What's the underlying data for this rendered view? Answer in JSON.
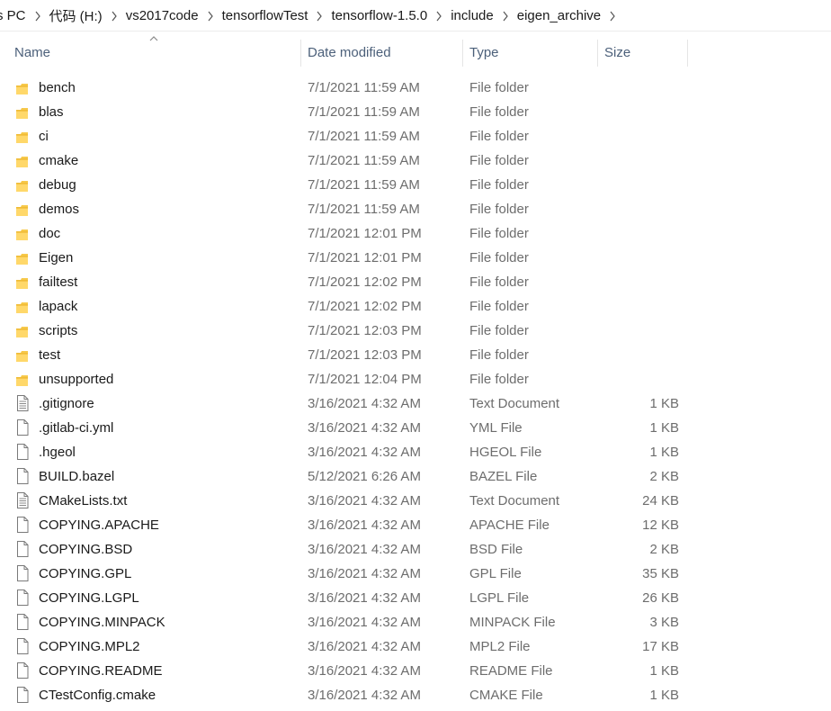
{
  "breadcrumb": [
    {
      "label": "s PC"
    },
    {
      "label": "代码 (H:)"
    },
    {
      "label": "vs2017code"
    },
    {
      "label": "tensorflowTest"
    },
    {
      "label": "tensorflow-1.5.0"
    },
    {
      "label": "include"
    },
    {
      "label": "eigen_archive"
    }
  ],
  "columns": {
    "name": "Name",
    "date": "Date modified",
    "type": "Type",
    "size": "Size"
  },
  "sort": {
    "column": "name",
    "direction": "ascending"
  },
  "colors": {
    "folder": "#f7c94b",
    "header_text": "#4c607a",
    "secondary_text": "#6d6d6d"
  },
  "files": [
    {
      "name": "bench",
      "date": "7/1/2021 11:59 AM",
      "type": "File folder",
      "size": "",
      "icon": "folder-icon"
    },
    {
      "name": "blas",
      "date": "7/1/2021 11:59 AM",
      "type": "File folder",
      "size": "",
      "icon": "folder-icon"
    },
    {
      "name": "ci",
      "date": "7/1/2021 11:59 AM",
      "type": "File folder",
      "size": "",
      "icon": "folder-icon"
    },
    {
      "name": "cmake",
      "date": "7/1/2021 11:59 AM",
      "type": "File folder",
      "size": "",
      "icon": "folder-icon"
    },
    {
      "name": "debug",
      "date": "7/1/2021 11:59 AM",
      "type": "File folder",
      "size": "",
      "icon": "folder-icon"
    },
    {
      "name": "demos",
      "date": "7/1/2021 11:59 AM",
      "type": "File folder",
      "size": "",
      "icon": "folder-icon"
    },
    {
      "name": "doc",
      "date": "7/1/2021 12:01 PM",
      "type": "File folder",
      "size": "",
      "icon": "folder-icon"
    },
    {
      "name": "Eigen",
      "date": "7/1/2021 12:01 PM",
      "type": "File folder",
      "size": "",
      "icon": "folder-icon"
    },
    {
      "name": "failtest",
      "date": "7/1/2021 12:02 PM",
      "type": "File folder",
      "size": "",
      "icon": "folder-icon"
    },
    {
      "name": "lapack",
      "date": "7/1/2021 12:02 PM",
      "type": "File folder",
      "size": "",
      "icon": "folder-icon"
    },
    {
      "name": "scripts",
      "date": "7/1/2021 12:03 PM",
      "type": "File folder",
      "size": "",
      "icon": "folder-icon"
    },
    {
      "name": "test",
      "date": "7/1/2021 12:03 PM",
      "type": "File folder",
      "size": "",
      "icon": "folder-icon"
    },
    {
      "name": "unsupported",
      "date": "7/1/2021 12:04 PM",
      "type": "File folder",
      "size": "",
      "icon": "folder-icon"
    },
    {
      "name": ".gitignore",
      "date": "3/16/2021 4:32 AM",
      "type": "Text Document",
      "size": "1 KB",
      "icon": "text-document-icon"
    },
    {
      "name": ".gitlab-ci.yml",
      "date": "3/16/2021 4:32 AM",
      "type": "YML File",
      "size": "1 KB",
      "icon": "file-icon"
    },
    {
      "name": ".hgeol",
      "date": "3/16/2021 4:32 AM",
      "type": "HGEOL File",
      "size": "1 KB",
      "icon": "file-icon"
    },
    {
      "name": "BUILD.bazel",
      "date": "5/12/2021 6:26 AM",
      "type": "BAZEL File",
      "size": "2 KB",
      "icon": "file-icon"
    },
    {
      "name": "CMakeLists.txt",
      "date": "3/16/2021 4:32 AM",
      "type": "Text Document",
      "size": "24 KB",
      "icon": "text-document-icon"
    },
    {
      "name": "COPYING.APACHE",
      "date": "3/16/2021 4:32 AM",
      "type": "APACHE File",
      "size": "12 KB",
      "icon": "file-icon"
    },
    {
      "name": "COPYING.BSD",
      "date": "3/16/2021 4:32 AM",
      "type": "BSD File",
      "size": "2 KB",
      "icon": "file-icon"
    },
    {
      "name": "COPYING.GPL",
      "date": "3/16/2021 4:32 AM",
      "type": "GPL File",
      "size": "35 KB",
      "icon": "file-icon"
    },
    {
      "name": "COPYING.LGPL",
      "date": "3/16/2021 4:32 AM",
      "type": "LGPL File",
      "size": "26 KB",
      "icon": "file-icon"
    },
    {
      "name": "COPYING.MINPACK",
      "date": "3/16/2021 4:32 AM",
      "type": "MINPACK File",
      "size": "3 KB",
      "icon": "file-icon"
    },
    {
      "name": "COPYING.MPL2",
      "date": "3/16/2021 4:32 AM",
      "type": "MPL2 File",
      "size": "17 KB",
      "icon": "file-icon"
    },
    {
      "name": "COPYING.README",
      "date": "3/16/2021 4:32 AM",
      "type": "README File",
      "size": "1 KB",
      "icon": "file-icon"
    },
    {
      "name": "CTestConfig.cmake",
      "date": "3/16/2021 4:32 AM",
      "type": "CMAKE File",
      "size": "1 KB",
      "icon": "file-icon"
    }
  ]
}
